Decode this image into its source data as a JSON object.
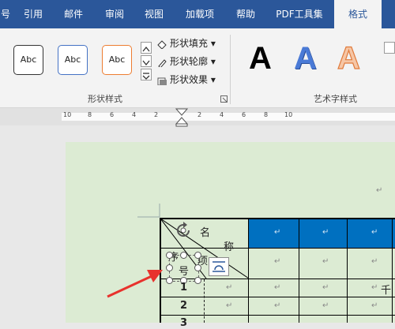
{
  "tabs": [
    {
      "label": "号",
      "active": false
    },
    {
      "label": "引用",
      "active": false
    },
    {
      "label": "邮件",
      "active": false
    },
    {
      "label": "审阅",
      "active": false
    },
    {
      "label": "视图",
      "active": false
    },
    {
      "label": "加载项",
      "active": false
    },
    {
      "label": "帮助",
      "active": false
    },
    {
      "label": "PDF工具集",
      "active": false
    },
    {
      "label": "格式",
      "active": true
    }
  ],
  "shape_styles": {
    "thumbnails": [
      "Abc",
      "Abc",
      "Abc"
    ],
    "commands": {
      "fill": "形状填充",
      "outline": "形状轮廓",
      "effects": "形状效果"
    },
    "group_label": "形状样式"
  },
  "wordart": {
    "letters": [
      "A",
      "A",
      "A"
    ],
    "group_label": "艺术字样式"
  },
  "ruler_numbers": [
    "10",
    "8",
    "6",
    "4",
    "2",
    "2",
    "4",
    "6",
    "8",
    "10"
  ],
  "paragraph_mark": "↵",
  "table": {
    "header_name": "名",
    "header_name2": "称",
    "header_item": "项",
    "header_num": "序",
    "header_num2": "号",
    "rows": [
      "1",
      "2",
      "3"
    ],
    "extra_char": "千"
  },
  "colors": {
    "brand": "#2b579a",
    "table_header": "#0070c0",
    "page": "#dcebd3",
    "arrow": "#e8322d"
  }
}
